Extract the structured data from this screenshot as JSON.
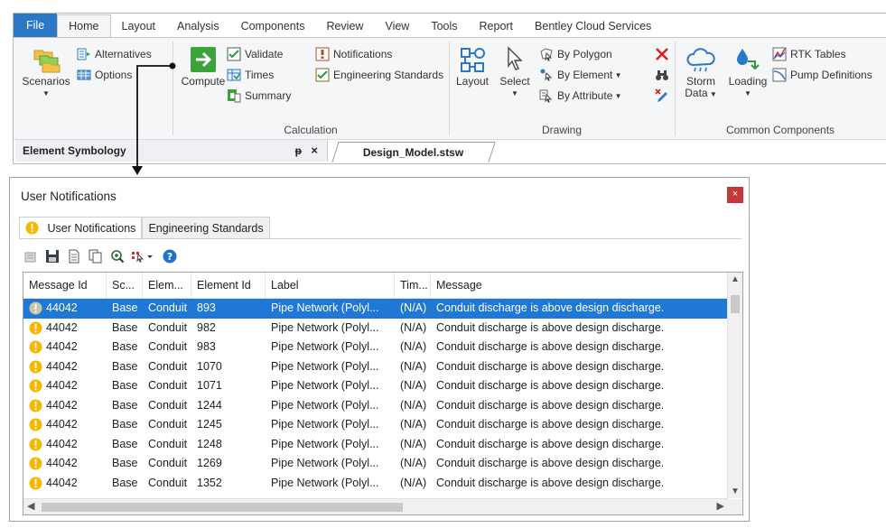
{
  "ribbon": {
    "tabs": [
      "File",
      "Home",
      "Layout",
      "Analysis",
      "Components",
      "Review",
      "View",
      "Tools",
      "Report",
      "Bentley Cloud Services"
    ],
    "active_tab": "Home",
    "scenarios": "Scenarios",
    "alternatives": "Alternatives",
    "options": "Options",
    "compute": "Compute",
    "validate": "Validate",
    "times": "Times",
    "summary": "Summary",
    "notifications": "Notifications",
    "engineering_standards": "Engineering Standards",
    "calculation_label": "Calculation",
    "layout": "Layout",
    "select": "Select",
    "by_polygon": "By Polygon",
    "by_element": "By Element",
    "by_attribute": "By Attribute",
    "drawing_label": "Drawing",
    "storm_data_1": "Storm",
    "storm_data_2": "Data",
    "loading": "Loading",
    "rtk_tables": "RTK Tables",
    "pump_definitions": "Pump Definitions",
    "common_components_label": "Common Components"
  },
  "panels": {
    "element_symbology": "Element Symbology",
    "pin_glyph": "ᵽ",
    "close_glyph": "×",
    "document_tab": "Design_Model.stsw"
  },
  "dialog": {
    "title": "User Notifications",
    "close_glyph": "×",
    "tabs": [
      "User Notifications",
      "Engineering Standards"
    ],
    "columns": [
      "Message Id",
      "Sc...",
      "Elem...",
      "Element Id",
      "Label",
      "Tim...",
      "Message"
    ],
    "rows": [
      [
        "44042",
        "Base",
        "Conduit",
        "893",
        "Pipe Network (Polyl...",
        "(N/A)",
        "Conduit discharge is above design discharge."
      ],
      [
        "44042",
        "Base",
        "Conduit",
        "982",
        "Pipe Network (Polyl...",
        "(N/A)",
        "Conduit discharge is above design discharge."
      ],
      [
        "44042",
        "Base",
        "Conduit",
        "983",
        "Pipe Network (Polyl...",
        "(N/A)",
        "Conduit discharge is above design discharge."
      ],
      [
        "44042",
        "Base",
        "Conduit",
        "1070",
        "Pipe Network (Polyl...",
        "(N/A)",
        "Conduit discharge is above design discharge."
      ],
      [
        "44042",
        "Base",
        "Conduit",
        "1071",
        "Pipe Network (Polyl...",
        "(N/A)",
        "Conduit discharge is above design discharge."
      ],
      [
        "44042",
        "Base",
        "Conduit",
        "1244",
        "Pipe Network (Polyl...",
        "(N/A)",
        "Conduit discharge is above design discharge."
      ],
      [
        "44042",
        "Base",
        "Conduit",
        "1245",
        "Pipe Network (Polyl...",
        "(N/A)",
        "Conduit discharge is above design discharge."
      ],
      [
        "44042",
        "Base",
        "Conduit",
        "1248",
        "Pipe Network (Polyl...",
        "(N/A)",
        "Conduit discharge is above design discharge."
      ],
      [
        "44042",
        "Base",
        "Conduit",
        "1269",
        "Pipe Network (Polyl...",
        "(N/A)",
        "Conduit discharge is above design discharge."
      ],
      [
        "44042",
        "Base",
        "Conduit",
        "1352",
        "Pipe Network (Polyl...",
        "(N/A)",
        "Conduit discharge is above design discharge."
      ]
    ],
    "selected_row": 0
  },
  "colors": {
    "file_tab": "#2b78c6",
    "selection": "#1f77d6",
    "warning": "#f5b800",
    "close": "#c6373b"
  }
}
